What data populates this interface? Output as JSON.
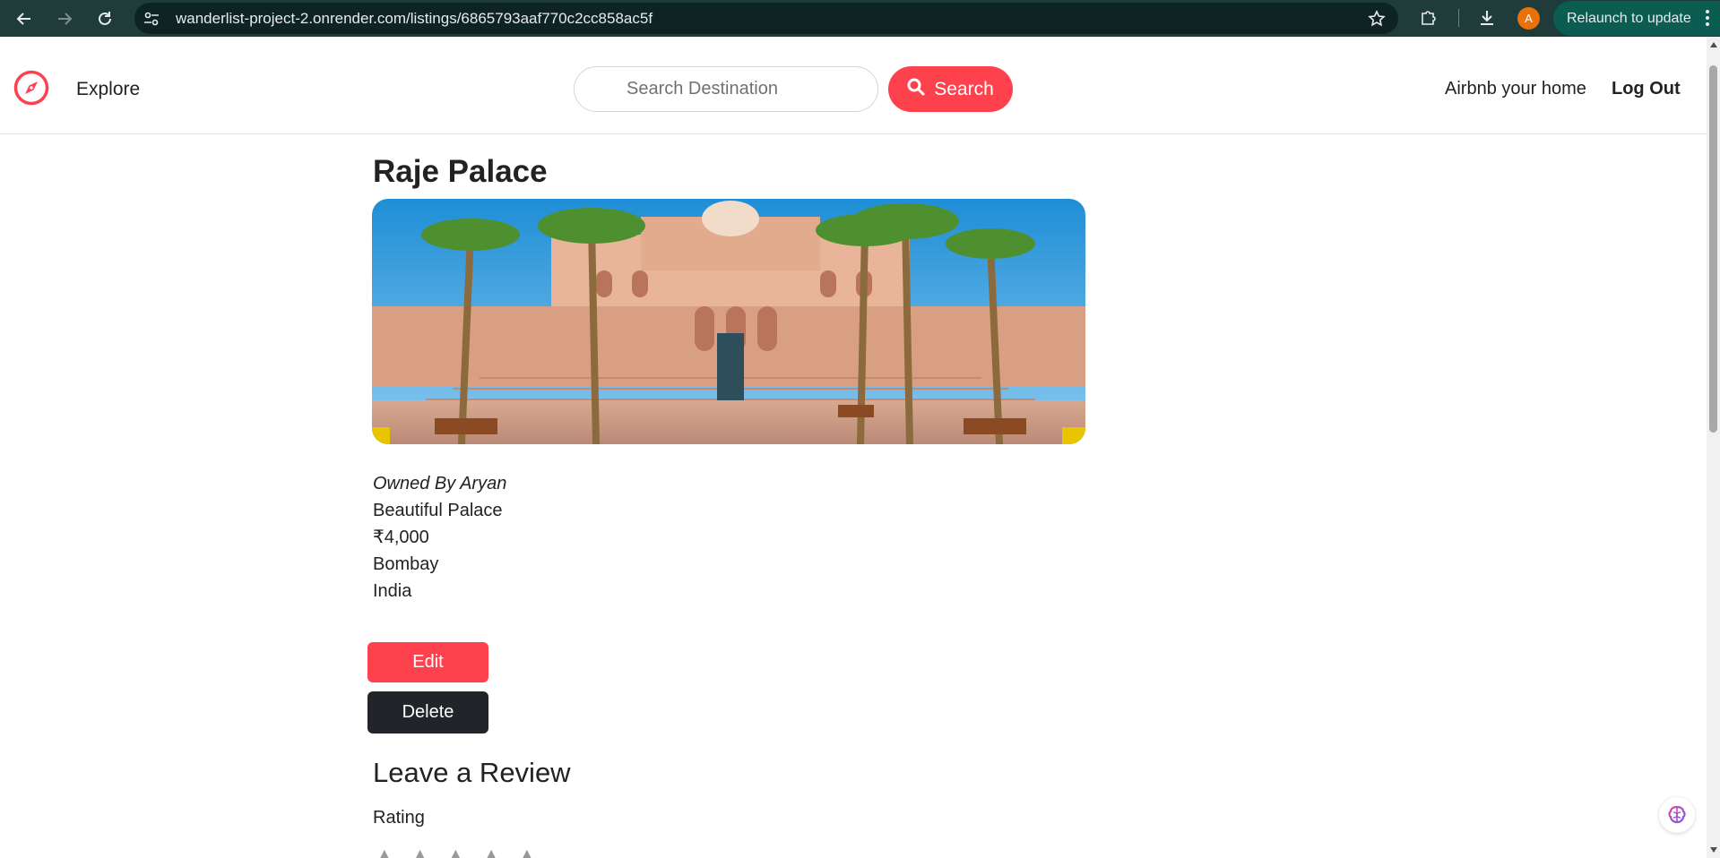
{
  "browser": {
    "url": "wanderlist-project-2.onrender.com/listings/6865793aaf770c2cc858ac5f",
    "profile_initial": "A",
    "relaunch_label": "Relaunch to update"
  },
  "navbar": {
    "explore_label": "Explore",
    "search_placeholder": "Search Destination",
    "search_button_label": "Search",
    "host_link": "Airbnb your home",
    "logout_link": "Log Out"
  },
  "listing": {
    "title": "Raje Palace",
    "owner": "Owned By Aryan",
    "description": "Beautiful Palace",
    "price": "₹4,000",
    "location": "Bombay",
    "country": "India",
    "edit_label": "Edit",
    "delete_label": "Delete"
  },
  "review": {
    "heading": "Leave a Review",
    "rating_label": "Rating",
    "star_count": 5
  },
  "colors": {
    "brand": "#fe424d",
    "dark_button": "#212529",
    "chrome_bg": "#1f3b3a",
    "relaunch_bg": "#0b5d52"
  }
}
